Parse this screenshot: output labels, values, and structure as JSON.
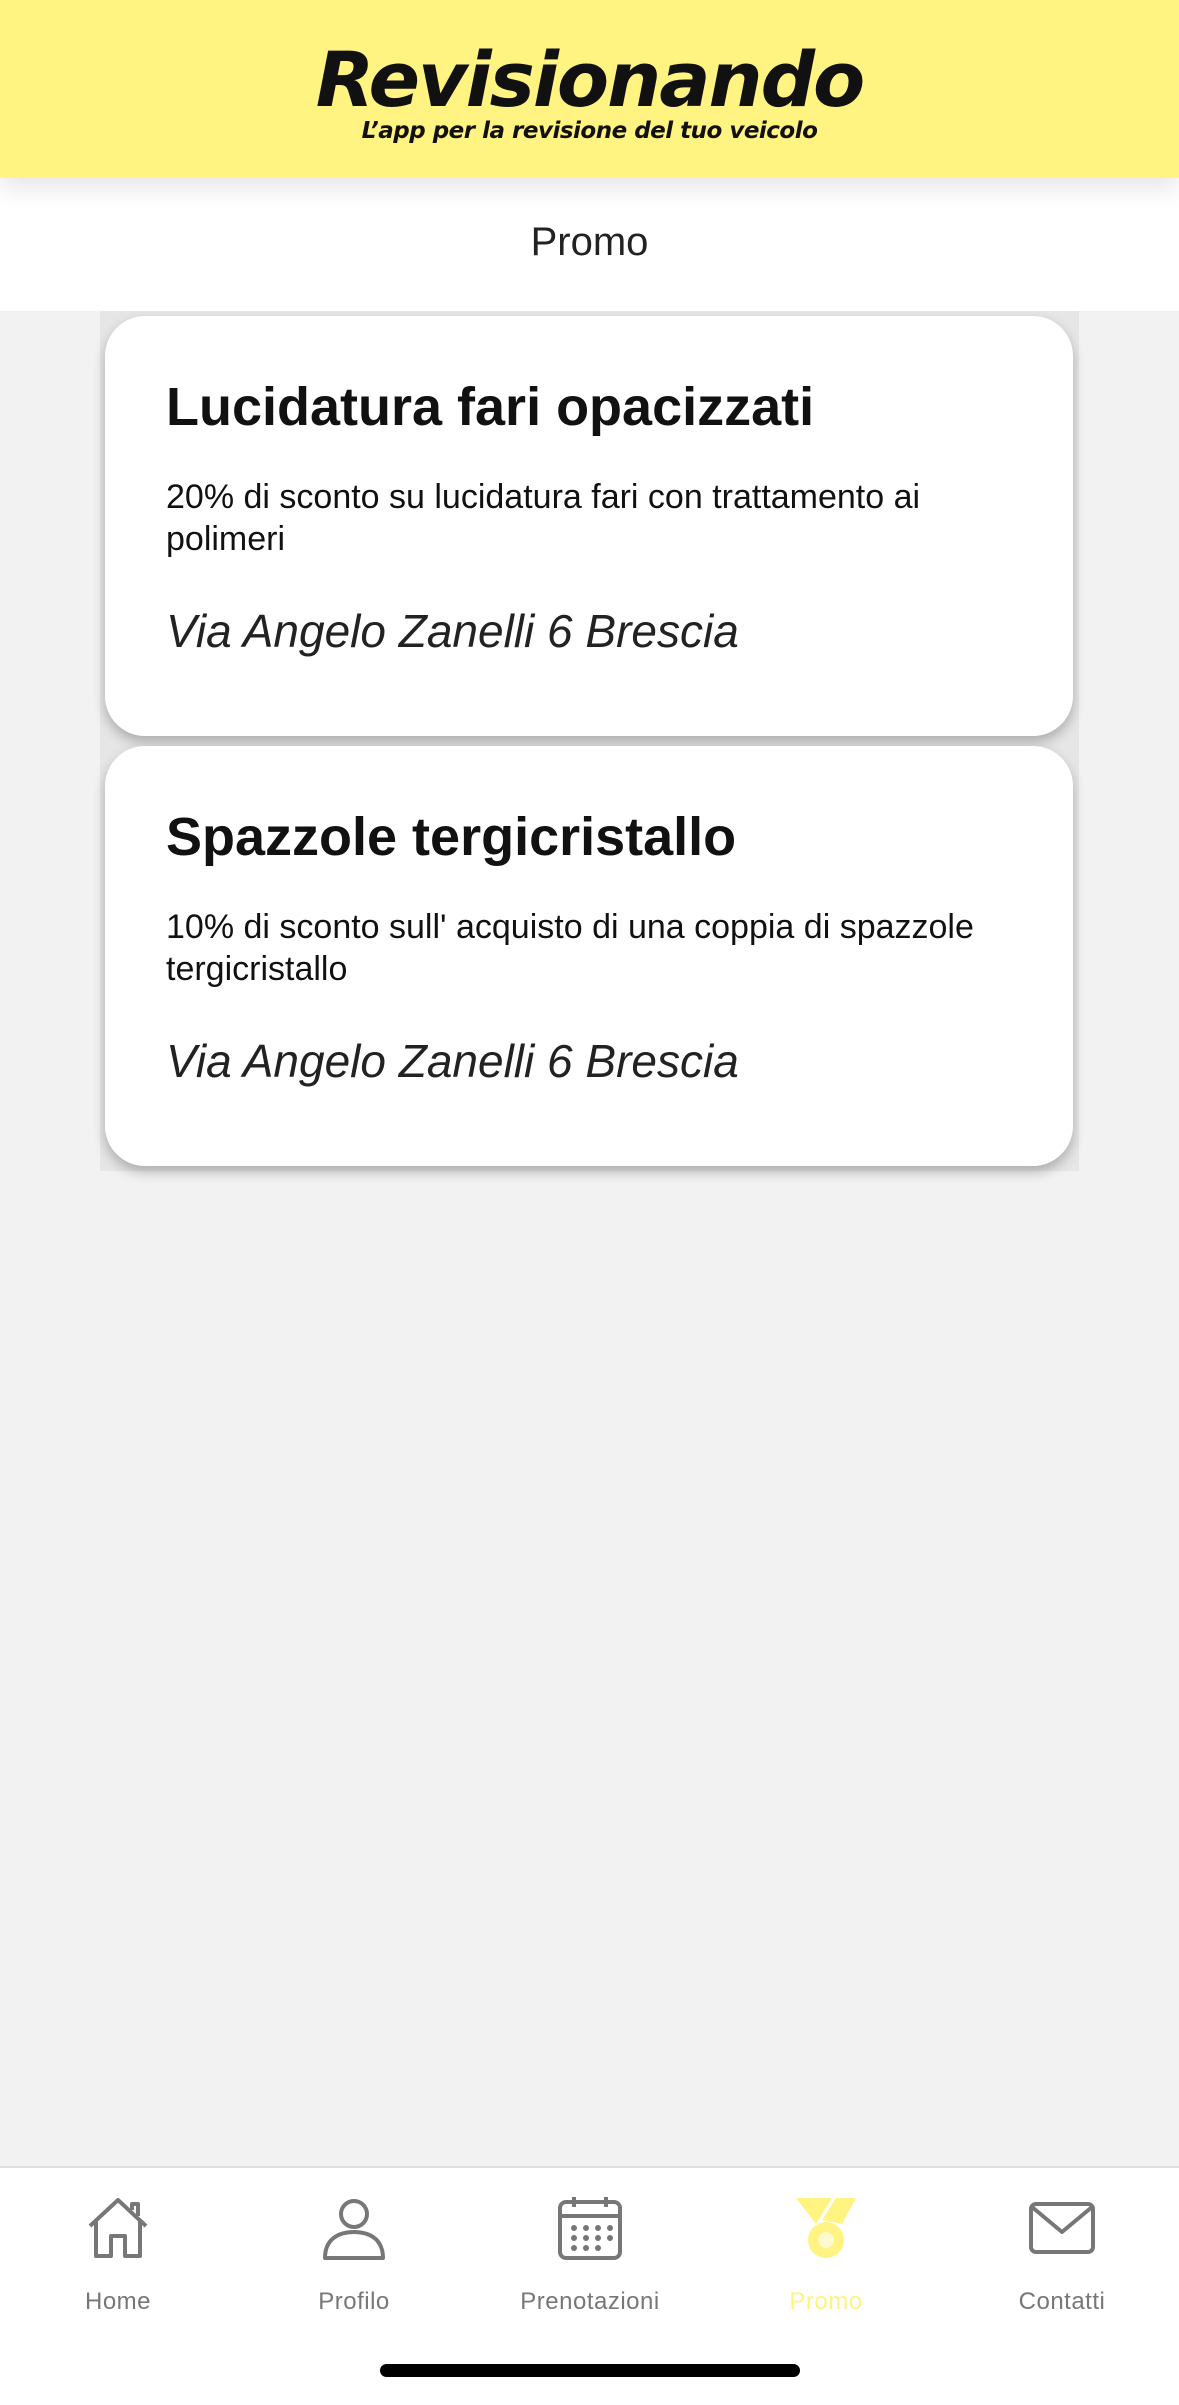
{
  "brand": {
    "title": "Revisionando",
    "tagline": "L’app per la revisione del tuo veicolo"
  },
  "header": {
    "title": "Promo"
  },
  "promos": [
    {
      "title": "Lucidatura fari opacizzati",
      "description": "20% di sconto su lucidatura fari con trattamento ai polimeri",
      "address": "Via Angelo Zanelli 6 Brescia"
    },
    {
      "title": "Spazzole tergicristallo",
      "description": "10% di sconto sull' acquisto di una coppia di spazzole tergicristallo",
      "address": "Via Angelo Zanelli 6 Brescia"
    }
  ],
  "tabs": [
    {
      "label": "Home",
      "icon": "home-icon"
    },
    {
      "label": "Profilo",
      "icon": "user-icon"
    },
    {
      "label": "Prenotazioni",
      "icon": "calendar-icon"
    },
    {
      "label": "Promo",
      "icon": "promo-badge-icon",
      "active": true
    },
    {
      "label": "Contatti",
      "icon": "mail-icon"
    }
  ],
  "colors": {
    "brand_yellow": "#fff382",
    "inactive_tab": "#777777",
    "background": "#f2f2f2"
  }
}
